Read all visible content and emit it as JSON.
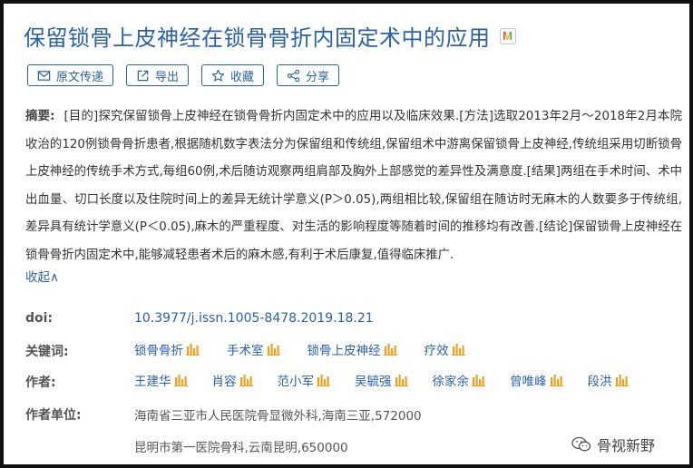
{
  "title": "保留锁骨上皮神经在锁骨骨折内固定术中的应用",
  "title_badge_icon": "m-logo-icon",
  "toolbar": [
    {
      "label": "原文传递",
      "icon": "mail-icon"
    },
    {
      "label": "导出",
      "icon": "export-icon"
    },
    {
      "label": "收藏",
      "icon": "star-icon"
    },
    {
      "label": "分享",
      "icon": "share-icon"
    }
  ],
  "abstract": {
    "label": "摘要:",
    "text": "[目的]探究保留锁骨上皮神经在锁骨骨折内固定术中的应用以及临床效果.[方法]选取2013年2月～2018年2月本院收治的120例锁骨骨折患者,根据随机数字表法分为保留组和传统组,保留组术中游离保留锁骨上皮神经,传统组采用切断锁骨上皮神经的传统手术方式,每组60例,术后随访观察两组肩部及胸外上部感觉的差异性及满意度.[结果]两组在手术时间、术中出血量、切口长度以及住院时间上的差异无统计学意义(P＞0.05),两组相比较,保留组在随访时无麻木的人数要多于传统组,差异具有统计学意义(P＜0.05),麻木的严重程度、对生活的影响程度等随着时间的推移均有改善.[结论]保留锁骨上皮神经在锁骨骨折内固定术中,能够减轻患者术后的麻木感,有利于术后康复,值得临床推广."
  },
  "collapse_label": "收起∧",
  "doi": {
    "label": "doi:",
    "value": "10.3977/j.issn.1005-8478.2019.18.21"
  },
  "keywords": {
    "label": "关键词:",
    "items": [
      "锁骨骨折",
      "手术室",
      "锁骨上皮神经",
      "疗效"
    ]
  },
  "authors": {
    "label": "作者:",
    "items": [
      "王建华",
      "肖容",
      "范小军",
      "吴毓强",
      "徐家余",
      "曾唯峰",
      "段洪"
    ]
  },
  "affiliations": {
    "label": "作者单位:",
    "items": [
      "海南省三亚市人民医院骨显微外科,海南三亚,572000",
      "昆明市第一医院骨科,云南昆明,650000"
    ]
  },
  "watermark": {
    "text": "骨视新野",
    "icon": "wechat-icon"
  },
  "colors": {
    "accent": "#2a61a7",
    "bar_icon": "#f0a020",
    "text": "#333333"
  }
}
